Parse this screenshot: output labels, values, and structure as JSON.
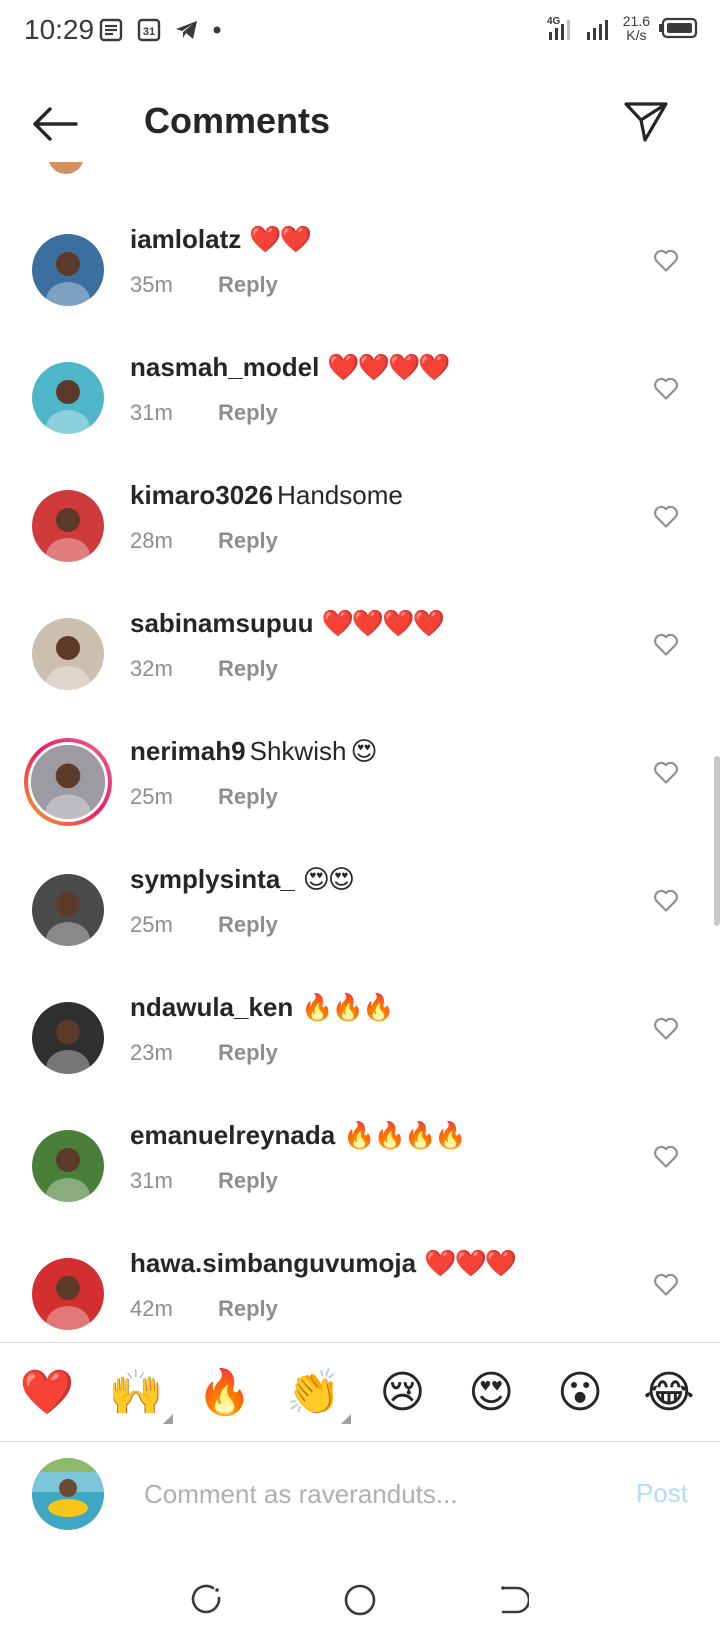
{
  "status": {
    "time": "10:29",
    "net_speed_value": "21.6",
    "net_speed_unit": "K/s",
    "network": "4G"
  },
  "header": {
    "title": "Comments"
  },
  "comments": [
    {
      "user": "iamlolatz",
      "text": "",
      "emoji": "❤️❤️",
      "time": "35m",
      "reply": "Reply",
      "avatar_color": "#3b6fa0"
    },
    {
      "user": "nasmah_model",
      "text": "",
      "emoji": "❤️❤️❤️❤️",
      "time": "31m",
      "reply": "Reply",
      "avatar_color": "#4fb6c9"
    },
    {
      "user": "kimaro3026",
      "text": "Handsome",
      "emoji": "",
      "time": "28m",
      "reply": "Reply",
      "avatar_color": "#cf3a3a"
    },
    {
      "user": "sabinamsupuu",
      "text": "",
      "emoji": "❤️❤️❤️❤️",
      "time": "32m",
      "reply": "Reply",
      "avatar_color": "#cdbfb0"
    },
    {
      "user": "nerimah9",
      "text": "Shkwish",
      "emoji": "😍",
      "time": "25m",
      "reply": "Reply",
      "avatar_color": "#9d9aa1"
    },
    {
      "user": "symplysinta_",
      "text": "",
      "emoji": "😍😍",
      "time": "25m",
      "reply": "Reply",
      "avatar_color": "#4a4a4a"
    },
    {
      "user": "ndawula_ken",
      "text": "",
      "emoji": "🔥🔥🔥",
      "time": "23m",
      "reply": "Reply",
      "avatar_color": "#2f2f2f"
    },
    {
      "user": "emanuelreynada",
      "text": "",
      "emoji": "🔥🔥🔥🔥",
      "time": "31m",
      "reply": "Reply",
      "avatar_color": "#4a7f3a"
    },
    {
      "user": "hawa.simbanguvumoja",
      "text": "",
      "emoji": "❤️❤️❤️",
      "time": "42m",
      "reply": "Reply",
      "avatar_color": "#d32f2f"
    }
  ],
  "reactions": [
    "❤️",
    "🙌",
    "🔥",
    "👏",
    "😢",
    "😍",
    "😮",
    "😂"
  ],
  "input": {
    "placeholder": "Comment as raveranduts...",
    "post_label": "Post"
  },
  "colors": {
    "accent_post_disabled": "#b3dbff",
    "meta_gray": "#8e8e8e",
    "story_ring": "#e91e63"
  }
}
